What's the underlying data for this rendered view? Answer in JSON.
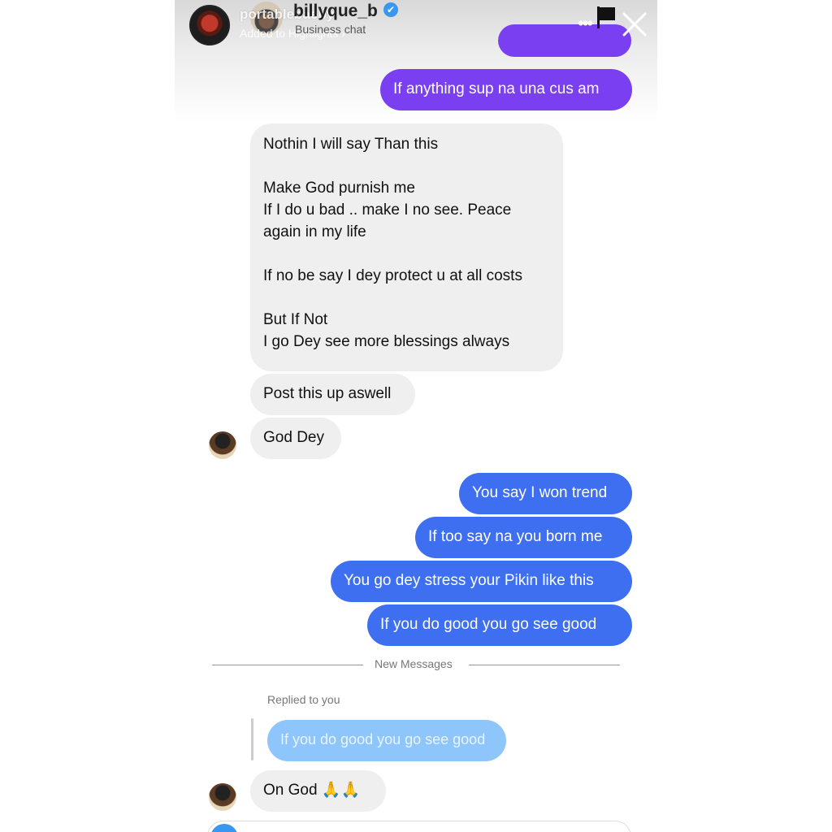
{
  "header": {
    "account_name": "portablebaeby",
    "account_subtitle": "Added to Highlights ›",
    "chat_name": "billyque_b",
    "chat_subtitle": "Business chat",
    "verified_mark": "✔",
    "more_label": "•••"
  },
  "messages": {
    "m1": "If anything sup na una cus am",
    "m2": "Nothin I will say Than this\n\nMake God purnish me\nIf I do u bad .. make I no see. Peace again in my life\n\nIf no be say I dey protect u at all costs\n\nBut If Not\nI go Dey see more blessings always",
    "m3": "Post this up aswell",
    "m4": "God Dey",
    "m5": "You say I won trend",
    "m6": "If too say na you born me",
    "m7": "You go dey stress your Pikin like this",
    "m8": "If you do good you go see good",
    "divider": "New Messages",
    "replied_label": "Replied to you",
    "reply_quote": "If you do good you go see good",
    "m9": "On God 🙏🙏"
  },
  "colors": {
    "purple_bubble": "#7b3ff2",
    "blue_bubble": "#3e6ff1",
    "incoming_bubble": "#efefef",
    "reply_quote": "#8ec5fb"
  }
}
